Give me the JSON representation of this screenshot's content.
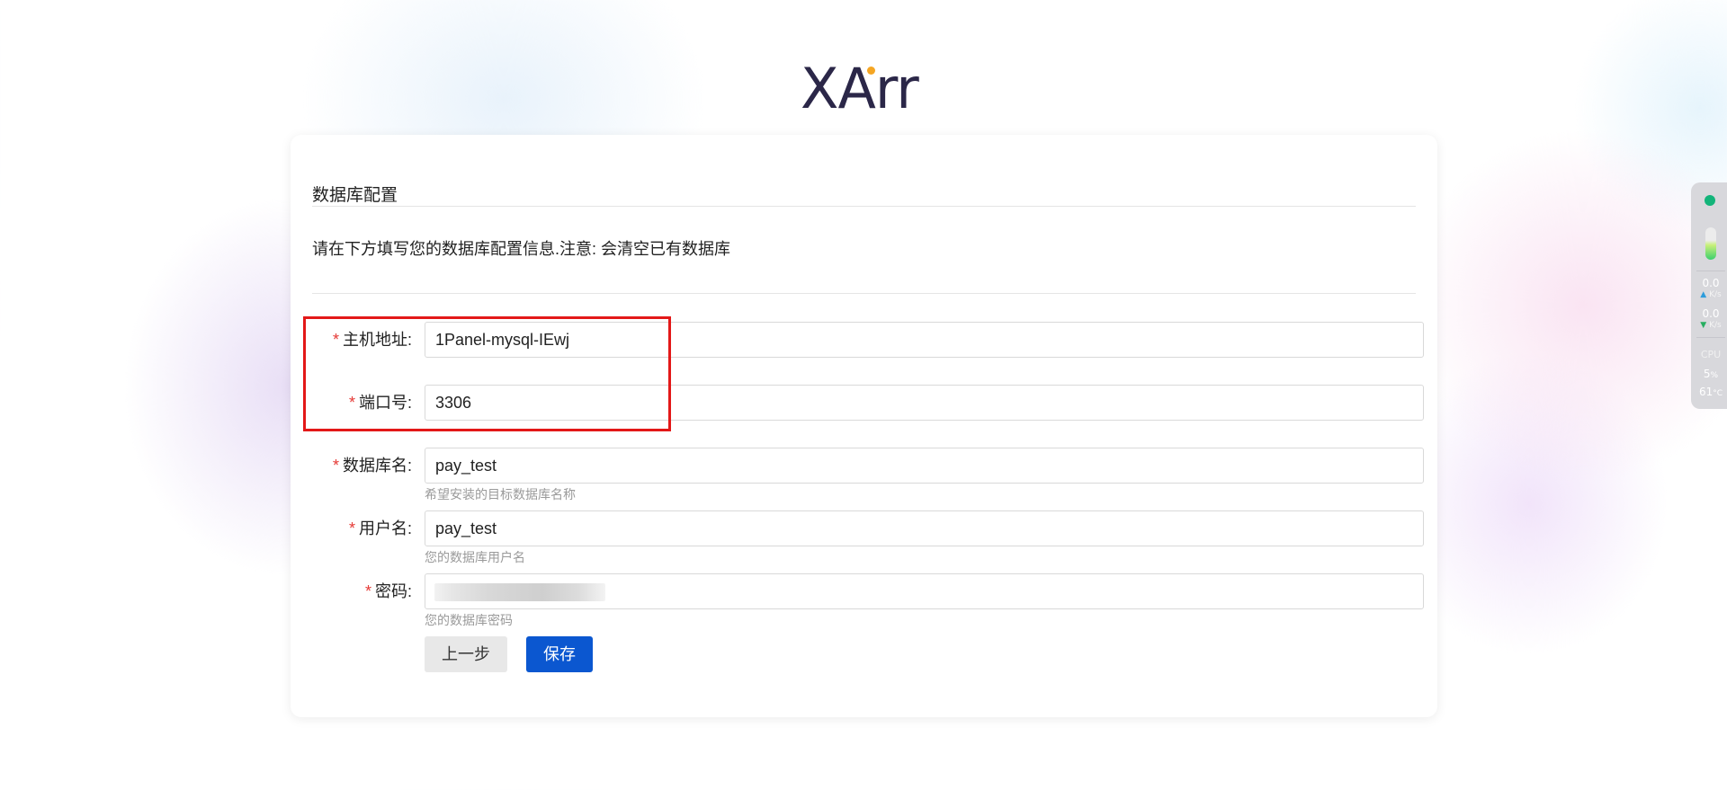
{
  "logo": {
    "text": "XArr"
  },
  "section": {
    "title": "数据库配置",
    "notice": "请在下方填写您的数据库配置信息.注意: 会清空已有数据库"
  },
  "form": {
    "required_mark": "*",
    "fields": [
      {
        "label": "主机地址:",
        "value": "1Panel-mysql-IEwj",
        "hint": ""
      },
      {
        "label": "端口号:",
        "value": "3306",
        "hint": ""
      },
      {
        "label": "数据库名:",
        "value": "pay_test",
        "hint": "希望安装的目标数据库名称"
      },
      {
        "label": "用户名:",
        "value": "pay_test",
        "hint": "您的数据库用户名"
      },
      {
        "label": "密码:",
        "value": "",
        "hint": "您的数据库密码"
      }
    ]
  },
  "buttons": {
    "prev": "上一步",
    "save": "保存"
  },
  "monitor": {
    "upload_speed": "0.0",
    "upload_unit": "K/s",
    "download_speed": "0.0",
    "download_unit": "K/s",
    "cpu_label": "CPU",
    "cpu_percent": "5",
    "cpu_percent_unit": "%",
    "temperature": "61",
    "temperature_unit": "°C",
    "status_color": "#13b47a"
  },
  "colors": {
    "primary": "#0b57d0",
    "required": "#e53935",
    "highlight": "#e31818",
    "logo": "#2b2748",
    "logo_accent": "#f5a623"
  }
}
